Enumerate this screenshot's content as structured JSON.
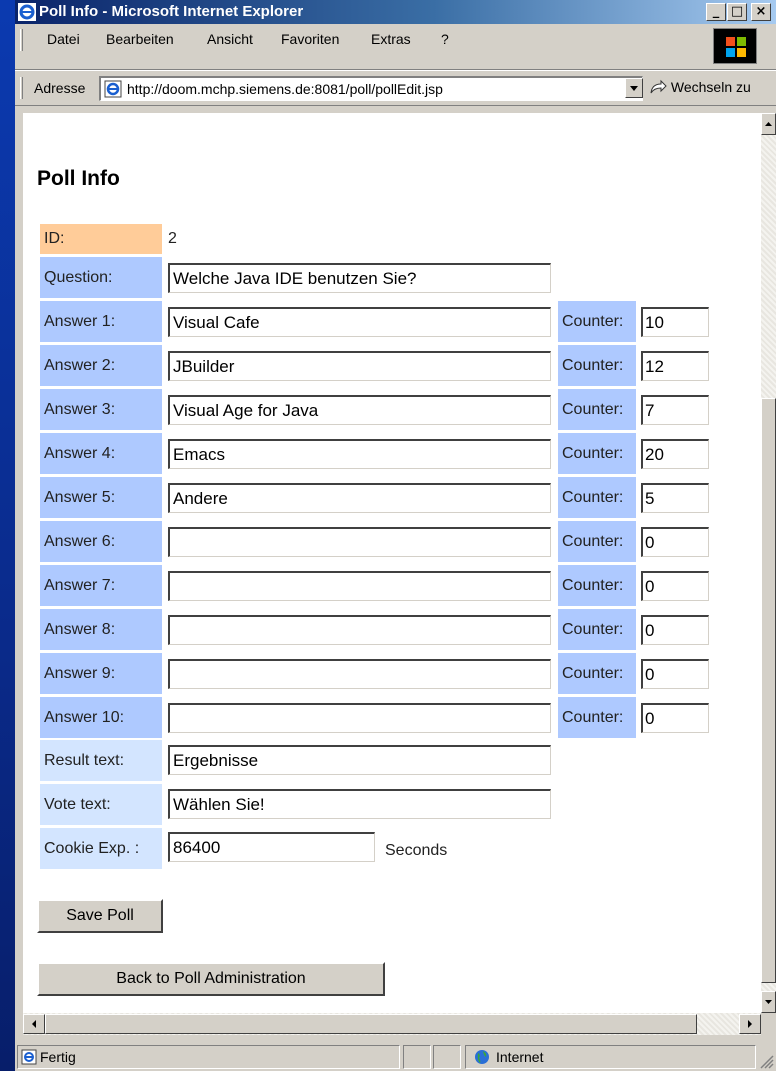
{
  "window": {
    "title": "Poll Info - Microsoft Internet Explorer",
    "min_glyph": "_",
    "max_glyph": "□",
    "close_glyph": "×"
  },
  "menu": {
    "items": [
      "Datei",
      "Bearbeiten",
      "Ansicht",
      "Favoriten",
      "Extras",
      "?"
    ]
  },
  "address": {
    "label": "Adresse",
    "url": "http://doom.mchp.siemens.de:8081/poll/pollEdit.jsp",
    "go_label": "Wechseln zu"
  },
  "page": {
    "heading": "Poll Info",
    "id_label": "ID:",
    "id_value": "2",
    "question_label": "Question:",
    "question_value": "Welche Java IDE benutzen Sie?",
    "counter_label": "Counter:",
    "answers": [
      {
        "label": "Answer 1:",
        "value": "Visual Cafe",
        "counter": "10"
      },
      {
        "label": "Answer 2:",
        "value": "JBuilder",
        "counter": "12"
      },
      {
        "label": "Answer 3:",
        "value": "Visual Age for Java",
        "counter": "7"
      },
      {
        "label": "Answer 4:",
        "value": "Emacs",
        "counter": "20"
      },
      {
        "label": "Answer 5:",
        "value": "Andere",
        "counter": "5"
      },
      {
        "label": "Answer 6:",
        "value": "",
        "counter": "0"
      },
      {
        "label": "Answer 7:",
        "value": "",
        "counter": "0"
      },
      {
        "label": "Answer 8:",
        "value": "",
        "counter": "0"
      },
      {
        "label": "Answer 9:",
        "value": "",
        "counter": "0"
      },
      {
        "label": "Answer 10:",
        "value": "",
        "counter": "0"
      }
    ],
    "result_label": "Result text:",
    "result_value": "Ergebnisse",
    "vote_label": "Vote text:",
    "vote_value": "Wählen Sie!",
    "cookie_label": "Cookie Exp. :",
    "cookie_value": "86400",
    "cookie_unit": "Seconds",
    "save_button": "Save Poll",
    "back_button": "Back to Poll Administration"
  },
  "status": {
    "text": "Fertig",
    "zone": "Internet"
  },
  "colors": {
    "id_label_bg": "#ffcc99",
    "label_bg": "#aec9ff",
    "light_label_bg": "#d3e5ff"
  }
}
